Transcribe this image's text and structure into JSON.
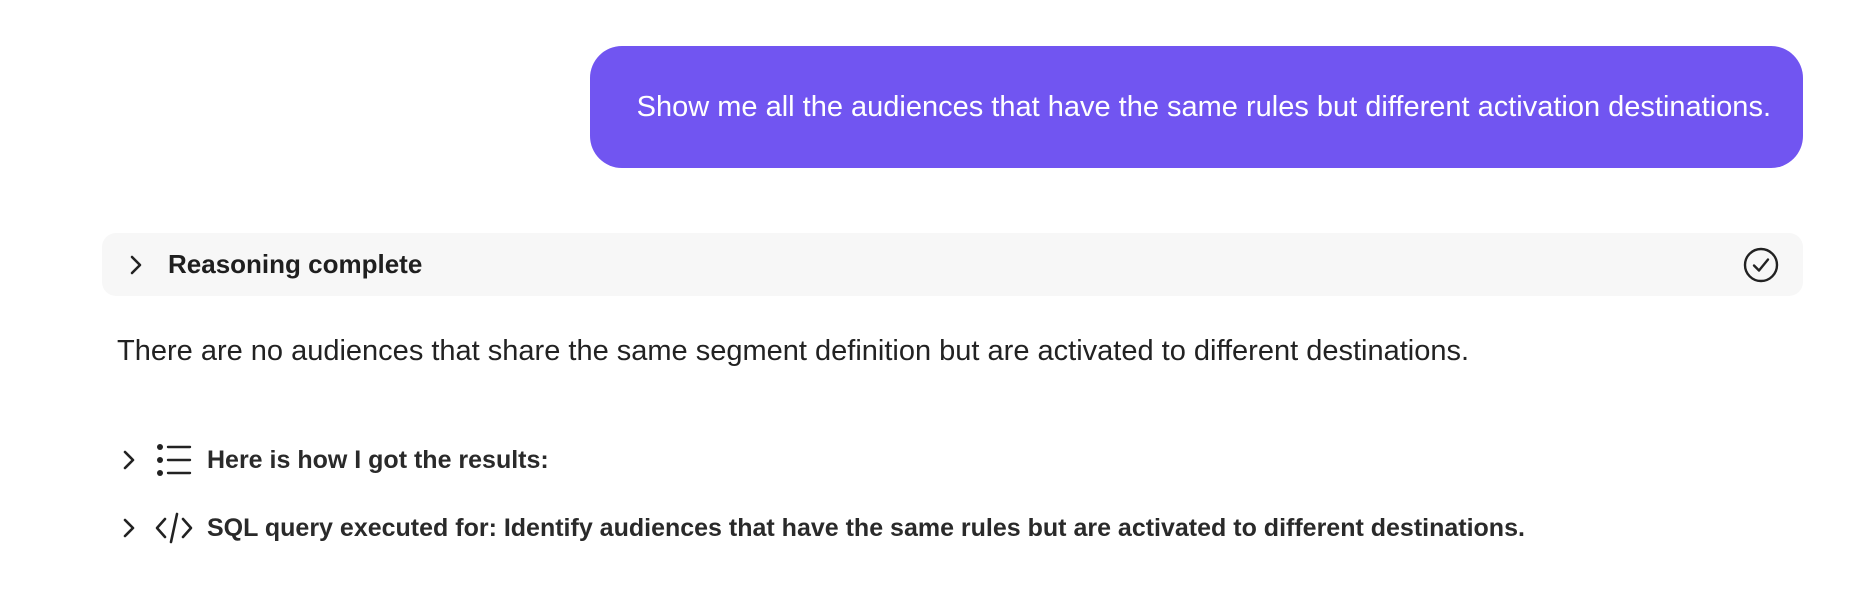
{
  "user_message": {
    "text": "Show me all the audiences that have the same rules but different activation destinations."
  },
  "reasoning": {
    "label": "Reasoning complete",
    "status_icon": "check-circle-icon",
    "expand_icon": "chevron-right-icon"
  },
  "answer": {
    "text": "There are no audiences that share the same segment definition but are activated to different destinations."
  },
  "details": [
    {
      "icon": "list-icon",
      "label": "Here is how I got the results:"
    },
    {
      "icon": "code-icon",
      "label": "SQL query executed for: Identify audiences that have the same rules but are activated to different destinations."
    }
  ],
  "colors": {
    "user_bubble": "#7155f1",
    "reasoning_bar": "#f7f7f7",
    "text": "#222222"
  }
}
